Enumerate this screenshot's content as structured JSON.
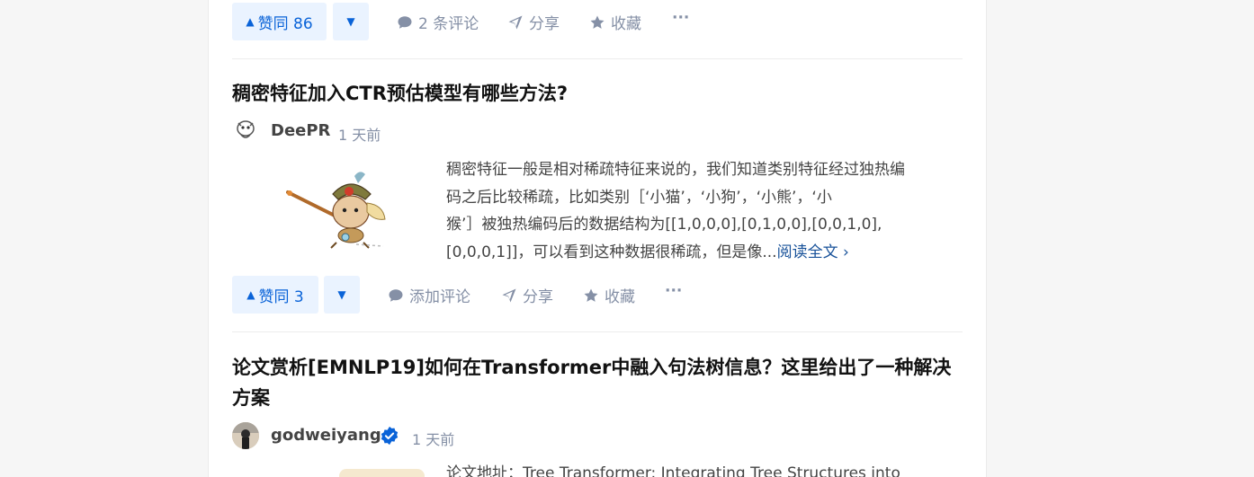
{
  "item1": {
    "vote_label": "赞同 86",
    "comments_label": "2 条评论",
    "share_label": "分享",
    "favorite_label": "收藏",
    "more_label": "···"
  },
  "item2": {
    "title": "稠密特征加入CTR预估模型有哪些方法?",
    "author": "DeePR",
    "time": "1 天前",
    "excerpt_lines": [
      "稠密特征一般是相对稀疏特征来说的，我们知道类别特征经过独热编",
      "码之后比较稀疏，比如类别［‘小猫’，‘小狗’，‘小熊’，‘小",
      "猴’］被独热编码后的数据结构为[[1,0,0,0],[0,1,0,0],[0,0,1,0],",
      "[0,0,0,1]]，可以看到这种数据很稀疏，但是像..."
    ],
    "read_more": "阅读全文 ›",
    "vote_label": "赞同 3",
    "comments_label": "添加评论",
    "share_label": "分享",
    "favorite_label": "收藏",
    "more_label": "···"
  },
  "item3": {
    "title": "论文赏析[EMNLP19]如何在Transformer中融入句法树信息？这里给出了一种解决方案",
    "author": "godweiyang",
    "time": "1 天前",
    "excerpt_partial": "论文地址：Tree Transformer: Integrating Tree Structures into"
  },
  "colors": {
    "accent": "#0a63d8",
    "vote_bg": "#eaf3ff",
    "muted": "#8590a6",
    "link": "#175199",
    "verified": "#0a63d8"
  },
  "icons": {
    "vote_up": "triangle-up-icon",
    "vote_down": "triangle-down-icon",
    "comment": "comment-icon",
    "share": "paper-plane-icon",
    "favorite": "star-icon",
    "more": "more-dots-icon",
    "verified": "verified-badge-icon"
  }
}
